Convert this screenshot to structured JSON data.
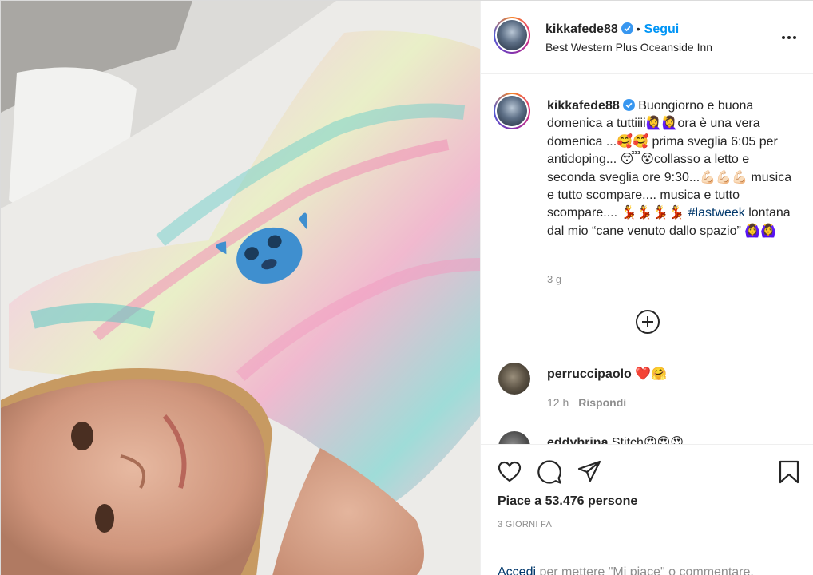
{
  "post": {
    "username": "kikkafede88",
    "follow_label": "Segui",
    "separator": "•",
    "location": "Best Western Plus Oceanside Inn",
    "caption_text": "Buongiorno e buona domenica a tuttiiii🙋‍♀️🙋‍♀️ora è una vera domenica ...🥰🥰 prima sveglia 6:05 per antidoping... 😴😵collasso a letto e seconda sveglia ore 9:30...💪🏻💪🏻💪🏻 musica e tutto scompare.... musica e tutto scompare.... 💃💃💃💃 ",
    "caption_hashtag": "#lastweek",
    "caption_tail": " lontana dal mio “cane venuto dallo spazio” 🙆‍♀️🙆‍♀️",
    "time": "3 g"
  },
  "comments": [
    {
      "username": "perruccipaolo",
      "text": "❤️🤗",
      "time": "12 h",
      "reply_label": "Rispondi"
    },
    {
      "username": "eddybrina",
      "text": "Stitch😍😍😍"
    }
  ],
  "actions": {
    "likes_prefix": "Piace a ",
    "likes_count": "53.476",
    "likes_suffix": " persone",
    "date": "3 GIORNI FA"
  },
  "login": {
    "link_label": "Accedi",
    "rest": " per mettere \"Mi piace\" o commentare."
  },
  "colors": {
    "accent": "#0095f6",
    "link": "#00376b",
    "muted": "#8e8e8e",
    "border": "#efefef",
    "verified": "#3897f0"
  },
  "icons": [
    "verified-badge-icon",
    "more-options-icon",
    "load-more-comments-icon",
    "heart-icon",
    "comment-icon",
    "share-icon",
    "bookmark-icon"
  ]
}
